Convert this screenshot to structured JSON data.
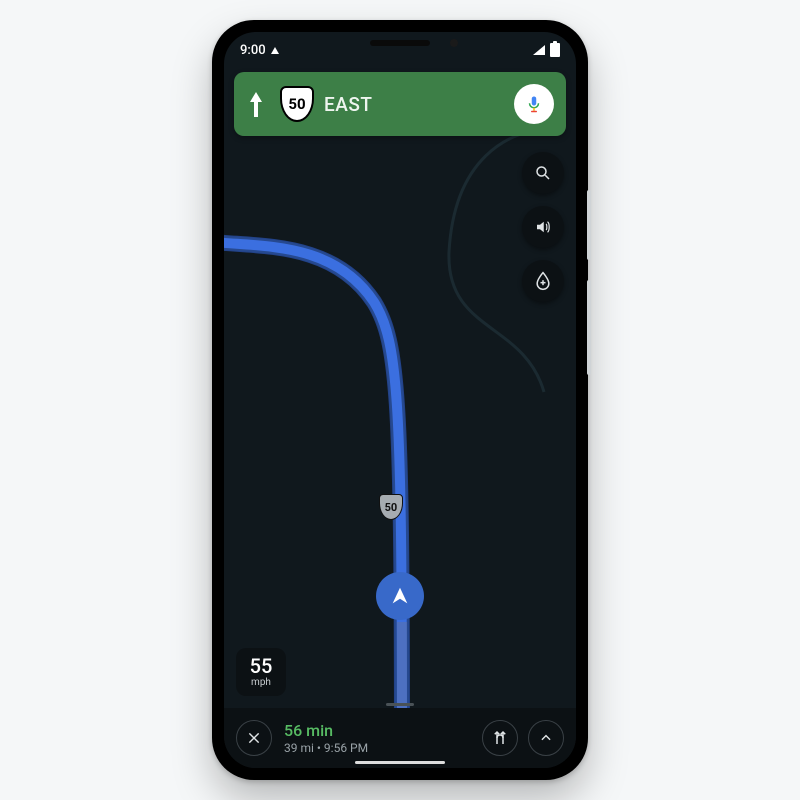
{
  "status": {
    "time": "9:00"
  },
  "direction": {
    "route_number": "50",
    "heading": "EAST"
  },
  "road_marker": {
    "number": "50"
  },
  "speed": {
    "value": "55",
    "unit": "mph"
  },
  "trip": {
    "eta": "56 min",
    "distance": "39 mi",
    "arrival": "9:56 PM",
    "separator": "  •  "
  },
  "icons": {
    "search": "search-icon",
    "sound": "sound-icon",
    "report": "report-icon",
    "voice": "voice-icon",
    "close": "close-icon",
    "alt_routes": "alt-routes-icon",
    "expand": "chevron-up-icon"
  },
  "colors": {
    "banner": "#3d7f47",
    "route": "#3b6fe0",
    "eta": "#57bb63"
  }
}
